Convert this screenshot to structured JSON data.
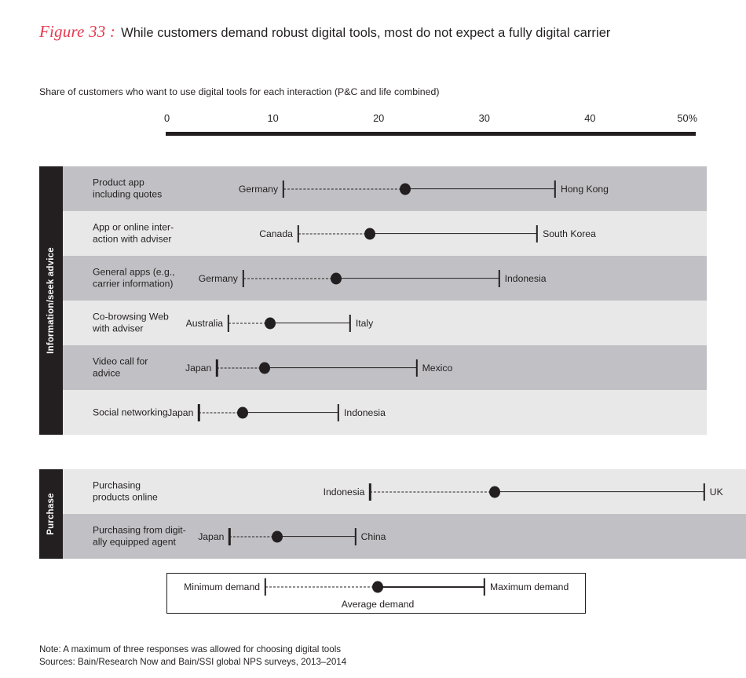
{
  "figure": {
    "number_label": "Figure 33 :",
    "title": "While customers demand robust digital tools, most do not expect a fully digital carrier",
    "subtitle": "Share of customers who want to use digital tools for each interaction (P&C and life combined)",
    "accent_color": "#e8384f",
    "ink_color": "#231f20",
    "row_shade_dark": "#c1c1c5",
    "row_shade_light": "#e8e8e8"
  },
  "axis": {
    "min": 0,
    "max": 50,
    "ticks": [
      {
        "value": 0,
        "label": "0"
      },
      {
        "value": 10,
        "label": "10"
      },
      {
        "value": 20,
        "label": "20"
      },
      {
        "value": 30,
        "label": "30"
      },
      {
        "value": 40,
        "label": "40"
      },
      {
        "value": 50,
        "label": "50%"
      }
    ]
  },
  "legend": {
    "min_label": "Minimum demand",
    "avg_label": "Average demand",
    "max_label": "Maximum demand",
    "min": 9,
    "avg": 20,
    "max": 31
  },
  "footnotes": {
    "note": "Note: A maximum of three responses was allowed for choosing digital tools",
    "sources": "Sources: Bain/Research Now and Bain/SSI global NPS surveys, 2013–2014"
  },
  "chart_data": {
    "type": "range-dot",
    "title": "While customers demand robust digital tools, most do not expect a fully digital carrier",
    "subtitle": "Share of customers who want to use digital tools for each interaction (P&C and life combined)",
    "xlabel": "",
    "ylabel": "",
    "xlim": [
      0,
      50
    ],
    "xtick_labels": [
      "0",
      "10",
      "20",
      "30",
      "40",
      "50%"
    ],
    "grid": false,
    "legend_position": "below-chart",
    "value_unit": "%",
    "groups": [
      {
        "name": "Information/seek advice",
        "rows": [
          {
            "category": "Product app\nincluding quotes",
            "category_line1": "Product app",
            "category_line2": "including quotes",
            "min_country": "Germany",
            "min": 11,
            "avg": 22.5,
            "max_country": "Hong Kong",
            "max": 36.7
          },
          {
            "category": "App or online inter-\naction with adviser",
            "category_line1": "App or online inter-",
            "category_line2": "action with adviser",
            "min_country": "Canada",
            "min": 12.4,
            "avg": 19.2,
            "max_country": "South Korea",
            "max": 35
          },
          {
            "category": "General apps (e.g.,\ncarrier information)",
            "category_line1": "General apps (e.g.,",
            "category_line2": "carrier information)",
            "min_country": "Germany",
            "min": 7.2,
            "avg": 16,
            "max_country": "Indonesia",
            "max": 31.4
          },
          {
            "category": "Co-browsing Web\nwith adviser",
            "category_line1": "Co-browsing Web",
            "category_line2": "with adviser",
            "min_country": "Australia",
            "min": 5.8,
            "avg": 9.7,
            "max_country": "Italy",
            "max": 17.3
          },
          {
            "category": "Video call for\nadvice",
            "category_line1": "Video call for",
            "category_line2": "advice",
            "min_country": "Japan",
            "min": 4.7,
            "avg": 9.2,
            "max_country": "Mexico",
            "max": 23.6
          },
          {
            "category": "Social networking",
            "category_line1": "Social networking",
            "category_line2": "",
            "min_country": "Japan",
            "min": 3.0,
            "avg": 7.1,
            "max_country": "Indonesia",
            "max": 16.2
          }
        ]
      },
      {
        "name": "Purchase",
        "rows": [
          {
            "category": "Purchasing\nproducts online",
            "category_line1": "Purchasing",
            "category_line2": "products online",
            "min_country": "Indonesia",
            "min": 19.2,
            "avg": 31,
            "max_country": "UK",
            "max": 50.8
          },
          {
            "category": "Purchasing from digit-\nally equipped agent",
            "category_line1": "Purchasing from digit-",
            "category_line2": "ally equipped agent",
            "min_country": "Japan",
            "min": 5.9,
            "avg": 10.4,
            "max_country": "China",
            "max": 17.8
          }
        ]
      }
    ]
  }
}
